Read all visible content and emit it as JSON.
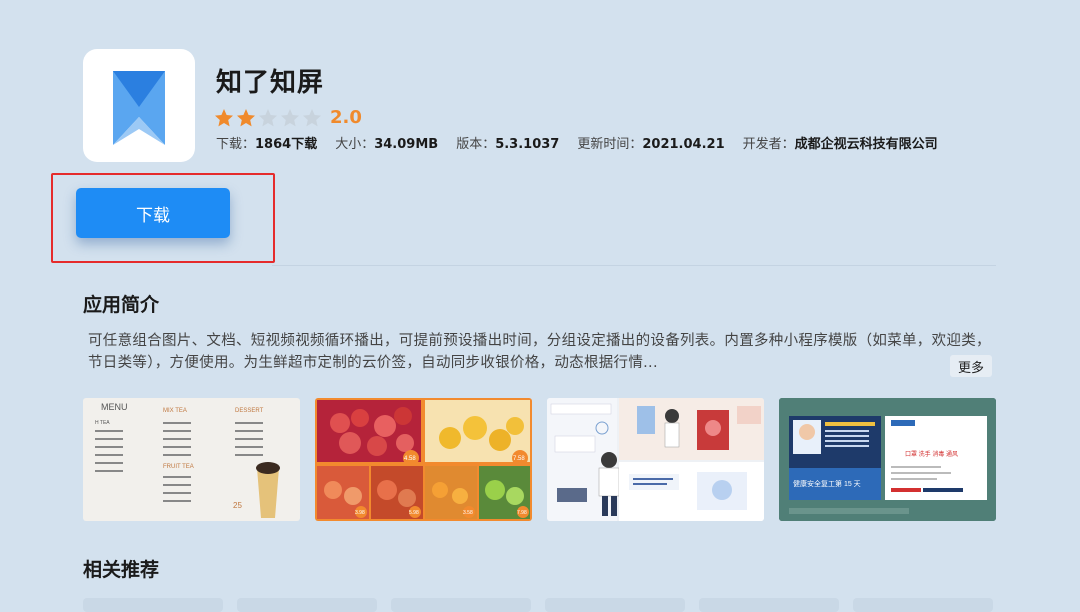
{
  "app": {
    "name": "知了知屏",
    "rating": 2.0,
    "rating_text": "2.0",
    "stars_total": 5,
    "stars_filled": 2,
    "icon": "app-logo-icon"
  },
  "meta": [
    {
      "key": "downloads",
      "label": "下载：",
      "value": "1864下载"
    },
    {
      "key": "size",
      "label": "大小：",
      "value": "34.09MB"
    },
    {
      "key": "version",
      "label": "版本：",
      "value": "5.3.1037"
    },
    {
      "key": "updated",
      "label": "更新时间：",
      "value": "2021.04.21"
    },
    {
      "key": "developer",
      "label": "开发者：",
      "value": "成都企视云科技有限公司"
    }
  ],
  "download_button": {
    "label": "下载"
  },
  "intro": {
    "title": "应用简介",
    "text": "可任意组合图片、文档、短视频视频循环播出，可提前预设播出时间，分组设定播出的设备列表。内置多种小程序模版（如菜单，欢迎类，节日类等），方便使用。为生鲜超市定制的云价签，自动同步收银价格，动态根据行情...",
    "more_label": "更多"
  },
  "screenshots": [
    {
      "name": "menu-screenshot",
      "texts": {
        "menu": "MENU",
        "milk_tea": "MIX TEA",
        "dessert": "DESSERT",
        "fruit_tea": "FRUIT TEA",
        "h_tea": "H TEA",
        "price": "25"
      }
    },
    {
      "name": "fruit-price-screenshot",
      "texts": {
        "p1": "4.58",
        "p2": "7.58",
        "p3": "3.98",
        "p4": "5.98",
        "p5": "3.58",
        "p6": "7.98"
      }
    },
    {
      "name": "cartoon-screenshot",
      "texts": {}
    },
    {
      "name": "safety-screenshot",
      "texts": {
        "banner": "健康安全复工第 15 天",
        "news": "口罩 洗手 消毒 通风"
      }
    }
  ],
  "related": {
    "title": "相关推荐"
  },
  "colors": {
    "background": "#d3e1ee",
    "accent": "#1e8cf5",
    "star_filled": "#f08a2c",
    "star_empty": "#c8d3dd",
    "focus": "#e52b2b"
  }
}
